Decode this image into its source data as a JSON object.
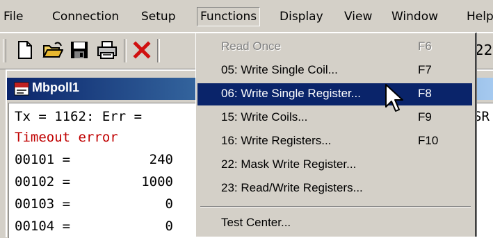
{
  "menubar": {
    "items": [
      "File",
      "Connection",
      "Setup",
      "Functions",
      "Display",
      "View",
      "Window",
      "Help"
    ],
    "active": "Functions"
  },
  "toolbar": {
    "buttons": [
      "new-file-icon",
      "open-folder-icon",
      "save-disk-icon",
      "print-icon",
      "delete-x-icon"
    ],
    "partial_text": "22"
  },
  "window": {
    "title": "Mbpoll1",
    "status_line": "Tx = 1162: Err =",
    "status_tail": "SR",
    "error_text": "Timeout error",
    "registers": [
      {
        "addr": "00101 =",
        "value": "240"
      },
      {
        "addr": "00102 =",
        "value": "1000"
      },
      {
        "addr": "00103 =",
        "value": "0"
      },
      {
        "addr": "00104 =",
        "value": "0"
      }
    ]
  },
  "functions_menu": {
    "items": [
      {
        "label": "Read Once",
        "shortcut": "F6",
        "disabled": true
      },
      {
        "label": "05: Write Single Coil...",
        "shortcut": "F7"
      },
      {
        "label": "06: Write Single Register...",
        "shortcut": "F8",
        "highlighted": true
      },
      {
        "label": "15: Write Coils...",
        "shortcut": "F9"
      },
      {
        "label": "16: Write Registers...",
        "shortcut": "F10"
      },
      {
        "label": "22: Mask Write Register...",
        "shortcut": ""
      },
      {
        "label": "23: Read/Write Registers...",
        "shortcut": ""
      },
      {
        "label": "Test Center...",
        "shortcut": ""
      }
    ]
  },
  "colors": {
    "highlight": "#0a246a",
    "error_text": "#c00000",
    "face": "#d4d0c8"
  }
}
